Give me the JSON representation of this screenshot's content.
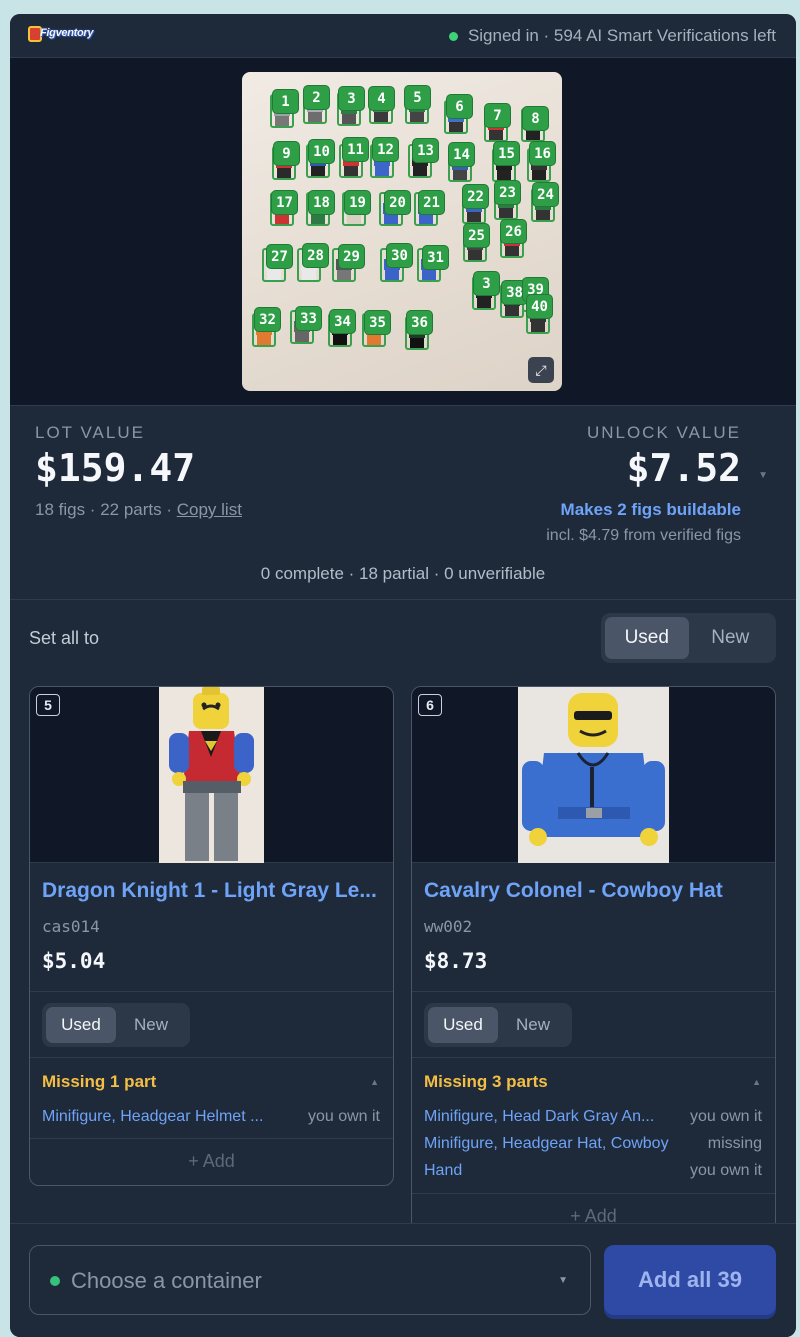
{
  "header": {
    "logo_text": "Figventory",
    "status_text": "Signed in · 594 AI Smart Verifications left"
  },
  "photo": {
    "expand_icon": "expand-icon",
    "tags": [
      "1",
      "2",
      "3",
      "4",
      "5",
      "6",
      "7",
      "8",
      "9",
      "10",
      "11",
      "12",
      "13",
      "14",
      "15",
      "16",
      "17",
      "18",
      "19",
      "20",
      "21",
      "22",
      "23",
      "24",
      "25",
      "26",
      "27",
      "28",
      "29",
      "30",
      "31",
      "3",
      "38",
      "39",
      "40",
      "32",
      "33",
      "34",
      "35",
      "36"
    ]
  },
  "summary": {
    "lot_label": "LOT VALUE",
    "lot_value": "$159.47",
    "lot_meta": "18 figs · 22 parts ·",
    "copy_list": "Copy list",
    "unlock_label": "UNLOCK VALUE",
    "unlock_value": "$7.52",
    "buildable": "Makes 2 figs buildable",
    "incl": "incl. $4.79 from verified figs",
    "counts": "0 complete · 18 partial · 0 unverifiable"
  },
  "set_all": {
    "label": "Set all to",
    "options": [
      "Used",
      "New"
    ],
    "selected": "Used"
  },
  "cards": [
    {
      "number": "5",
      "name": "Dragon Knight 1 - Light Gray Le...",
      "code": "cas014",
      "price": "$5.04",
      "condition_options": [
        "Used",
        "New"
      ],
      "missing": "Missing 1 part",
      "parts": [
        {
          "name": "Minifigure, Headgear Helmet ...",
          "status": "you own it"
        }
      ],
      "add_label": "+ Add"
    },
    {
      "number": "6",
      "name": "Cavalry Colonel - Cowboy Hat",
      "code": "ww002",
      "price": "$8.73",
      "condition_options": [
        "Used",
        "New"
      ],
      "missing": "Missing 3 parts",
      "parts": [
        {
          "name": "Minifigure, Head Dark Gray An...",
          "status": "you own it"
        },
        {
          "name": "Minifigure, Headgear Hat, Cowboy",
          "status": "missing"
        },
        {
          "name": "Hand",
          "status": "you own it"
        }
      ],
      "add_label": "+ Add"
    }
  ],
  "footer": {
    "container_placeholder": "Choose a container",
    "add_all_label": "Add all 39"
  },
  "colors": {
    "accent_blue": "#6fa3f7",
    "warning_yellow": "#f4be45",
    "success_green": "#3ed37a",
    "primary_button": "#2e4aa4"
  }
}
